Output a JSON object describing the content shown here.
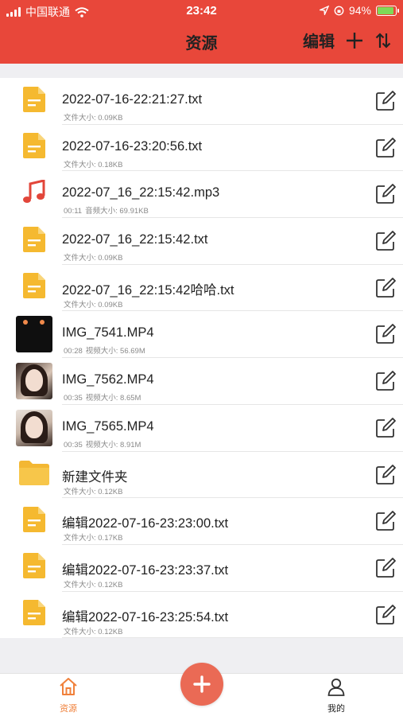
{
  "status_bar": {
    "carrier": "中国联通",
    "time": "23:42",
    "battery": "94%",
    "battery_level": 0.94
  },
  "header": {
    "title": "资源",
    "edit_label": "编辑",
    "add_icon": "plus-icon",
    "sort_icon": "sort-arrows-icon",
    "background_color": "#e8473a"
  },
  "files": [
    {
      "name": "2022-07-16-22:21:27.txt",
      "duration": "",
      "size": "文件大小: 0.09KB",
      "kind": "text"
    },
    {
      "name": "2022-07-16-23:20:56.txt",
      "duration": "",
      "size": "文件大小: 0.18KB",
      "kind": "text"
    },
    {
      "name": "2022-07_16_22:15:42.mp3",
      "duration": "00:11",
      "size": "音频大小: 69.91KB",
      "kind": "audio"
    },
    {
      "name": "2022-07_16_22:15:42.txt",
      "duration": "",
      "size": "文件大小: 0.09KB",
      "kind": "text"
    },
    {
      "name": "2022-07_16_22:15:42哈哈.txt",
      "duration": "",
      "size": "文件大小: 0.09KB",
      "kind": "text"
    },
    {
      "name": "IMG_7541.MP4",
      "duration": "00:28",
      "size": "视频大小: 56.69M",
      "kind": "video"
    },
    {
      "name": "IMG_7562.MP4",
      "duration": "00:35",
      "size": "视频大小: 8.65M",
      "kind": "video"
    },
    {
      "name": "IMG_7565.MP4",
      "duration": "00:35",
      "size": "视频大小: 8.91M",
      "kind": "video"
    },
    {
      "name": "新建文件夹",
      "duration": "",
      "size": "文件大小: 0.12KB",
      "kind": "folder"
    },
    {
      "name": "编辑2022-07-16-23:23:00.txt",
      "duration": "",
      "size": "文件大小: 0.17KB",
      "kind": "text"
    },
    {
      "name": "编辑2022-07-16-23:23:37.txt",
      "duration": "",
      "size": "文件大小: 0.12KB",
      "kind": "text"
    },
    {
      "name": "编辑2022-07-16-23:25:54.txt",
      "duration": "",
      "size": "文件大小: 0.12KB",
      "kind": "text"
    }
  ],
  "tabbar": {
    "home_label": "资源",
    "me_label": "我的",
    "add_icon": "plus-icon",
    "active_color": "#f0803a",
    "fab_color": "#ea6a55"
  },
  "icons": {
    "text_file": "document-icon",
    "audio_file": "music-note-icon",
    "folder": "folder-icon",
    "edit": "edit-icon"
  }
}
